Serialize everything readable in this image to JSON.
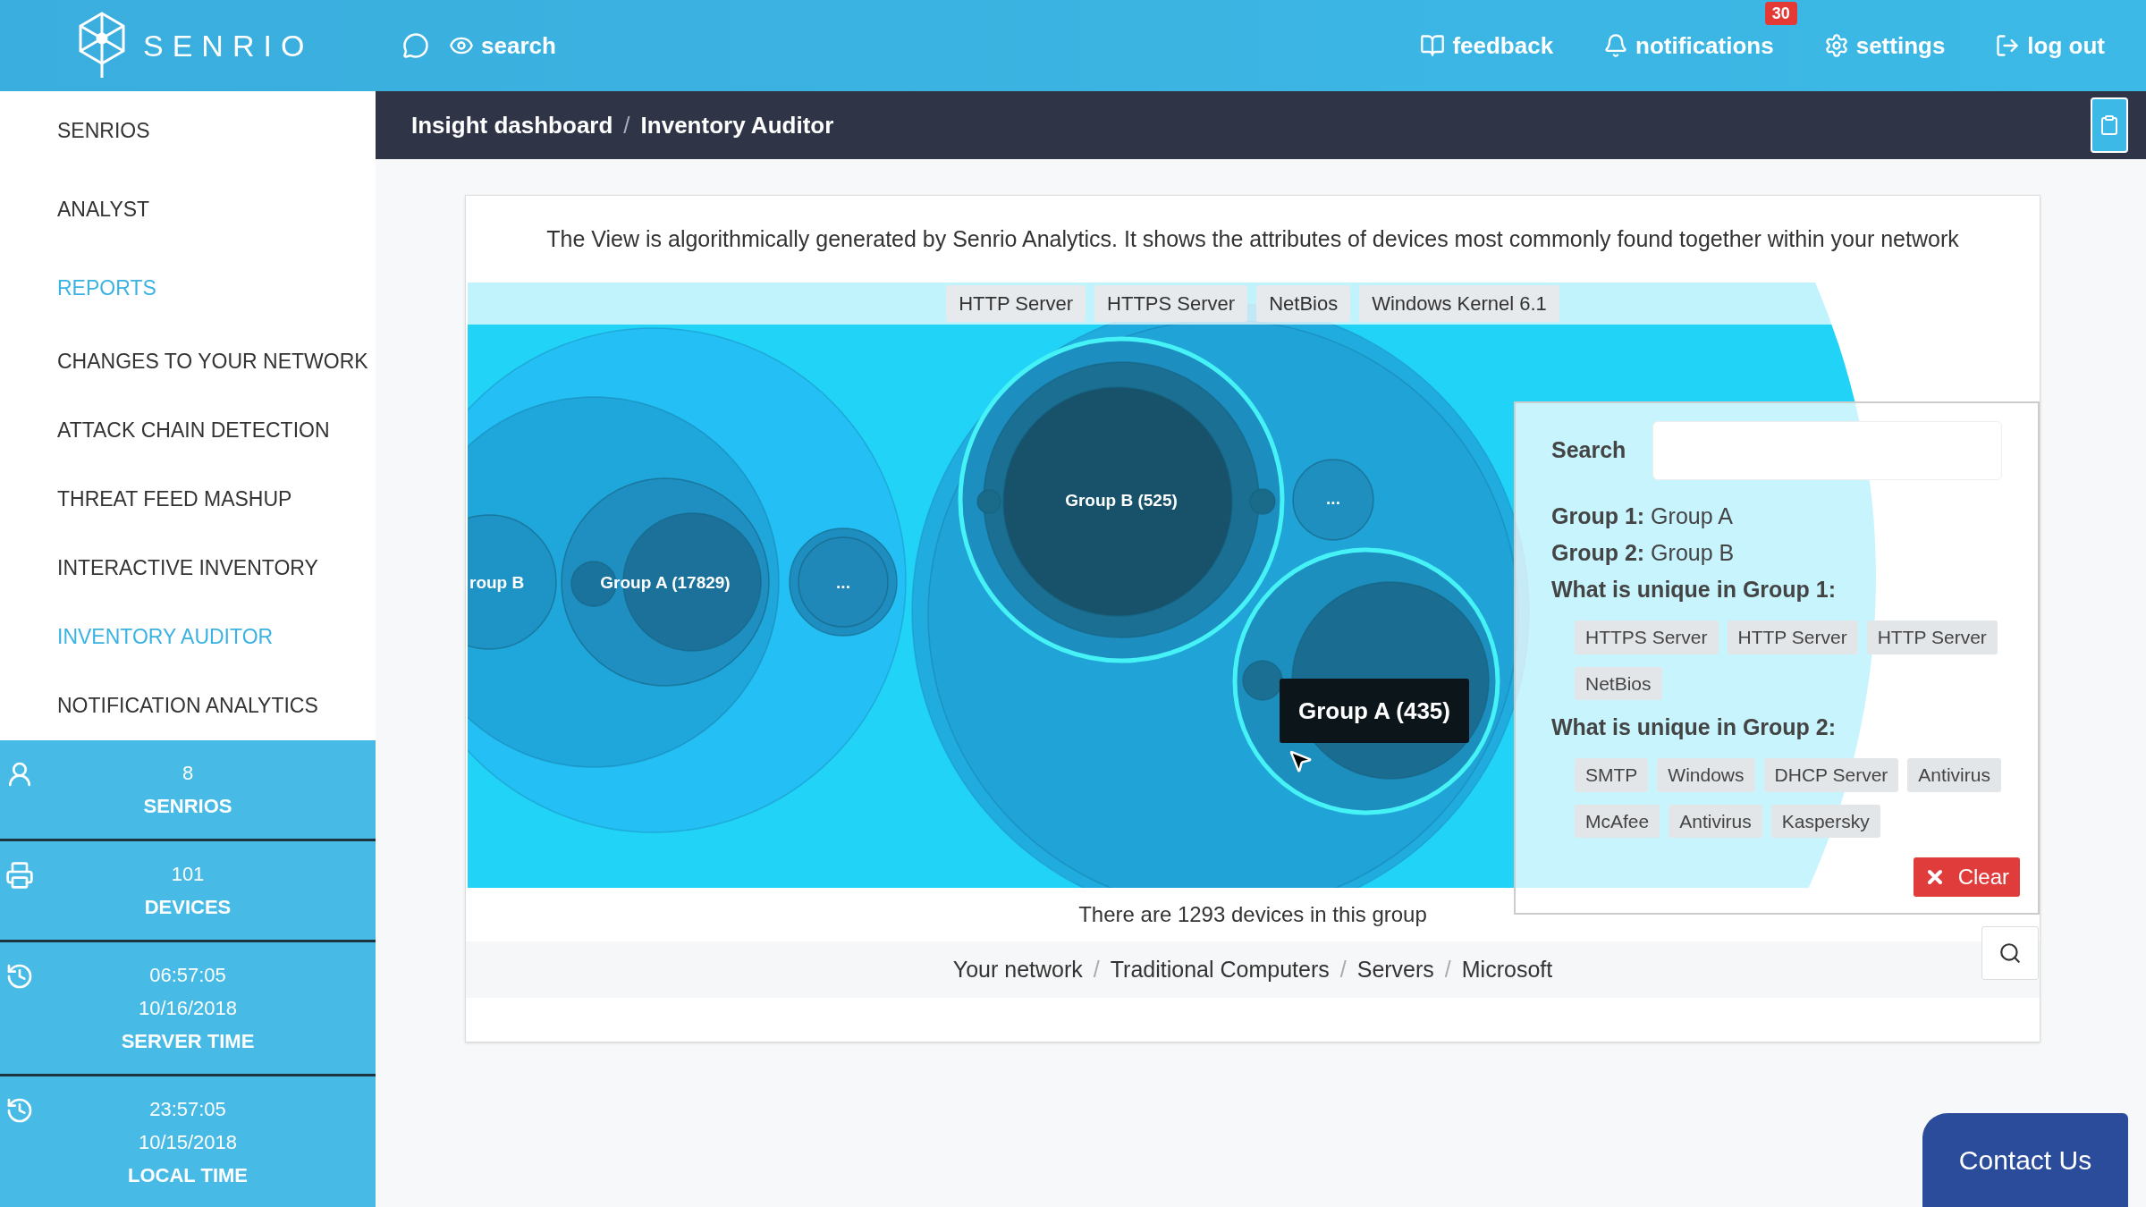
{
  "brand": {
    "name": "SENRIO"
  },
  "topbar": {
    "search_label": "search",
    "actions": [
      {
        "kind": "feedback",
        "label": "feedback"
      },
      {
        "kind": "notifications",
        "label": "notifications",
        "badge": "30"
      },
      {
        "kind": "settings",
        "label": "settings"
      },
      {
        "kind": "logout",
        "label": "log out"
      }
    ]
  },
  "sidebar": {
    "items": [
      {
        "label": "SENRIOS",
        "selected": false
      },
      {
        "label": "ANALYST",
        "selected": false
      },
      {
        "label": "REPORTS",
        "selected": true
      },
      {
        "label": "CHANGES TO YOUR NETWORK",
        "selected": false
      },
      {
        "label": "ATTACK CHAIN DETECTION",
        "selected": false
      },
      {
        "label": "THREAT FEED MASHUP",
        "selected": false
      },
      {
        "label": "INTERACTIVE INVENTORY",
        "selected": false
      },
      {
        "label": "INVENTORY AUDITOR",
        "selected": true
      },
      {
        "label": "NOTIFICATION ANALYTICS",
        "selected": false
      }
    ]
  },
  "stats": [
    {
      "kind": "senrios",
      "lines": [
        "8"
      ],
      "label": "SENRIOS"
    },
    {
      "kind": "devices",
      "lines": [
        "101"
      ],
      "label": "DEVICES"
    },
    {
      "kind": "clock",
      "lines": [
        "06:57:05",
        "10/16/2018"
      ],
      "label": "SERVER TIME"
    },
    {
      "kind": "clock",
      "lines": [
        "23:57:05",
        "10/15/2018"
      ],
      "label": "LOCAL TIME"
    }
  ],
  "breadcrumb": [
    {
      "label": "Insight dashboard"
    },
    {
      "separator": "/",
      "label": "Inventory Auditor"
    }
  ],
  "card": {
    "description": "The View is algorithmically generated by Senrio Analytics. It shows the attributes of devices most commonly found together within your network",
    "attribute_tags": [
      "HTTP Server",
      "HTTPS Server",
      "NetBios",
      "Windows Kernel 6.1"
    ],
    "bubbles": [
      {
        "label": "roup B",
        "highlighted": false
      },
      {
        "label": "Group A (17829)",
        "highlighted": false
      },
      {
        "label": "...",
        "highlighted": false
      },
      {
        "label": "Group B (525)",
        "highlighted": true
      },
      {
        "label": "...",
        "highlighted": false
      },
      {
        "highlighted": true
      }
    ],
    "tooltip": "Group A (435)",
    "caption": "There are 1293 devices in this group",
    "path": [
      {
        "label": "Your network"
      },
      {
        "separator": "/",
        "label": "Traditional Computers"
      },
      {
        "separator": "/",
        "label": "Servers"
      },
      {
        "separator": "/",
        "label": "Microsoft"
      }
    ]
  },
  "compare_panel": {
    "search_label": "Search",
    "group1": "**Group 1:** Group A",
    "group2": "**Group 2:** Group B",
    "unique1_heading": "What is unique in Group 1:",
    "unique1": [
      "HTTPS Server",
      "HTTP Server",
      "HTTP Server",
      "NetBios"
    ],
    "unique2_heading": "What is unique in Group 2:",
    "unique2": [
      "SMTP",
      "Windows",
      "DHCP Server",
      "Antivirus",
      "McAfee",
      "Antivirus",
      "Kaspersky"
    ],
    "clear_button": "Clear"
  },
  "contact_button": "Contact Us"
}
